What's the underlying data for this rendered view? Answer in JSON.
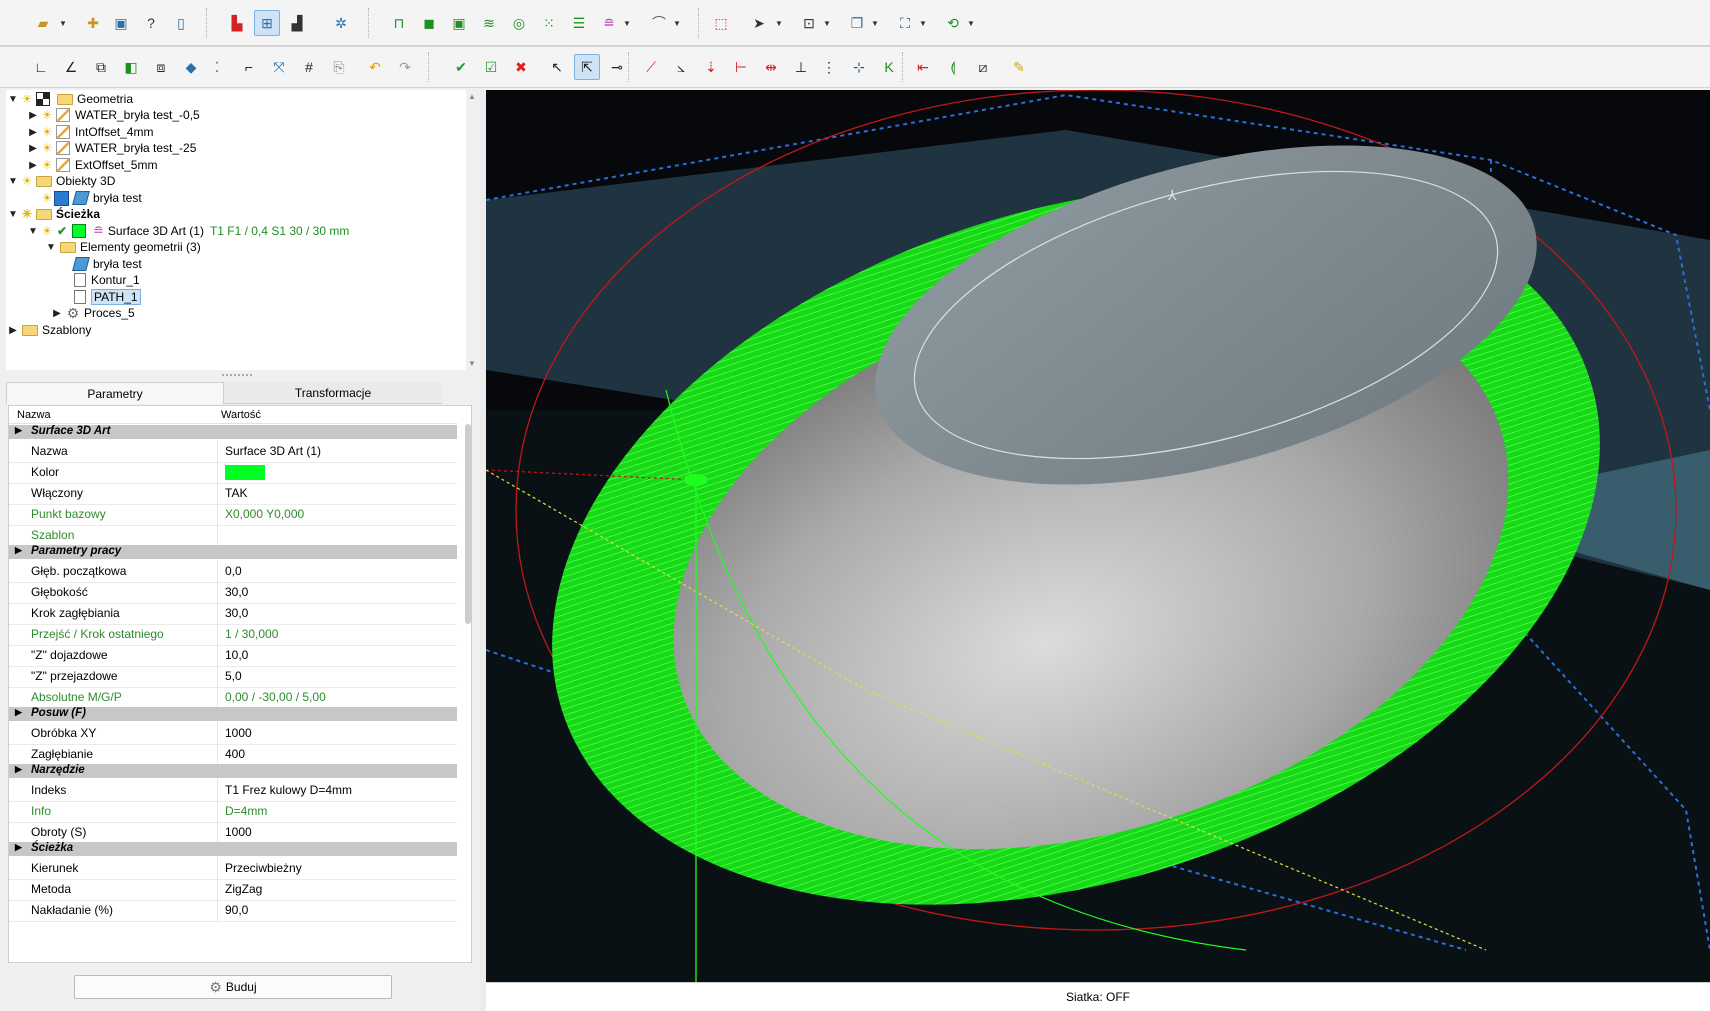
{
  "tree": {
    "items": [
      {
        "label": "Geometria"
      },
      {
        "label": "WATER_bryła test_-0,5"
      },
      {
        "label": "IntOffset_4mm"
      },
      {
        "label": "WATER_bryła test_-25"
      },
      {
        "label": "ExtOffset_5mm"
      },
      {
        "label": "Obiekty 3D"
      },
      {
        "label": "bryła test"
      },
      {
        "label": "Ścieżka"
      },
      {
        "label": "Surface 3D Art (1)",
        "info": "T1  F1 / 0,4  S1  30 / 30 mm"
      },
      {
        "label": "Elementy geometrii (3)"
      },
      {
        "label": "bryła test"
      },
      {
        "label": "Kontur_1"
      },
      {
        "label": "PATH_1"
      },
      {
        "label": "Proces_5"
      },
      {
        "label": "Szablony"
      }
    ]
  },
  "tabs": {
    "parametry": "Parametry",
    "transformacje": "Transformacje"
  },
  "props": {
    "head_name": "Nazwa",
    "head_value": "Wartość",
    "rows": [
      {
        "cat": "Surface 3D Art"
      },
      {
        "k": "Nazwa",
        "v": "Surface 3D Art (1)"
      },
      {
        "k": "Kolor",
        "v": ""
      },
      {
        "k": "Włączony",
        "v": "TAK"
      },
      {
        "k": "Punkt bazowy",
        "v": "X0,000  Y0,000"
      },
      {
        "k": "Szablon",
        "v": ""
      },
      {
        "cat": "Parametry pracy"
      },
      {
        "k": "Głęb. początkowa",
        "v": "0,0"
      },
      {
        "k": "Głębokość",
        "v": "30,0"
      },
      {
        "k": "Krok zagłębiania",
        "v": "30,0"
      },
      {
        "k": "Przejść / Krok ostatniego",
        "v": "1 / 30,000"
      },
      {
        "k": "\"Z\" dojazdowe",
        "v": "10,0"
      },
      {
        "k": "\"Z\" przejazdowe",
        "v": "5,0"
      },
      {
        "k": "Absolutne M/G/P",
        "v": "0,00 / -30,00 / 5,00"
      },
      {
        "cat": "Posuw (F)"
      },
      {
        "k": "Obróbka XY",
        "v": "1000"
      },
      {
        "k": "Zagłębianie",
        "v": "400"
      },
      {
        "cat": "Narzędzie"
      },
      {
        "k": "Indeks",
        "v": "T1 Frez kulowy D=4mm"
      },
      {
        "k": "Info",
        "v": "D=4mm"
      },
      {
        "k": "Obroty (S)",
        "v": "1000"
      },
      {
        "cat": "Ścieżka"
      },
      {
        "k": "Kierunek",
        "v": "Przeciwbieżny"
      },
      {
        "k": "Metoda",
        "v": "ZigZag"
      },
      {
        "k": "Nakładanie (%)",
        "v": "90,0"
      }
    ]
  },
  "build_label": "Buduj",
  "status": "Siatka: OFF",
  "colors": {
    "toolpath": "#00ff22",
    "accent": "#2a7bd1"
  }
}
